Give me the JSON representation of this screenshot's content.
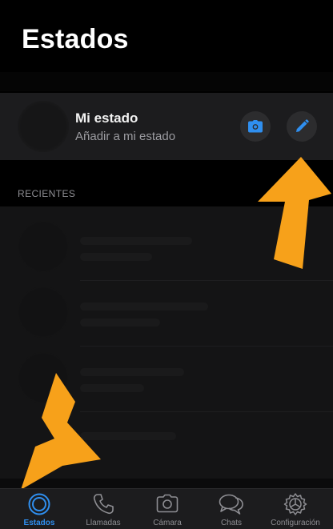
{
  "header": {
    "title": "Estados"
  },
  "my_status": {
    "name": "Mi estado",
    "subtitle": "Añadir a mi estado",
    "camera_icon": "camera-icon",
    "edit_icon": "pencil-icon"
  },
  "recent": {
    "section_label": "RECIENTES"
  },
  "tabbar": {
    "tabs": [
      {
        "label": "Estados",
        "icon": "status-ring-icon",
        "active": true
      },
      {
        "label": "Llamadas",
        "icon": "phone-icon",
        "active": false
      },
      {
        "label": "Cámara",
        "icon": "camera-icon",
        "active": false
      },
      {
        "label": "Chats",
        "icon": "chat-bubbles-icon",
        "active": false
      },
      {
        "label": "Configuración",
        "icon": "gear-icon",
        "active": false
      }
    ]
  },
  "colors": {
    "accent": "#2f8ff0",
    "highlight_arrow": "#f7a11a",
    "background": "#000000"
  }
}
